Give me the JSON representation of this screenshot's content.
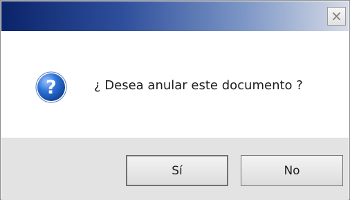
{
  "window": {
    "title": "",
    "close_label": "×"
  },
  "dialog": {
    "icon": "question-icon",
    "message": "¿ Desea anular este documento ?"
  },
  "buttons": {
    "yes_label": "Sí",
    "no_label": "No"
  },
  "colors": {
    "titlebar_start": "#0a246a",
    "titlebar_end": "#d6dbe6",
    "icon_blue": "#1f5fbf",
    "footer_bg": "#e3e3e3"
  }
}
